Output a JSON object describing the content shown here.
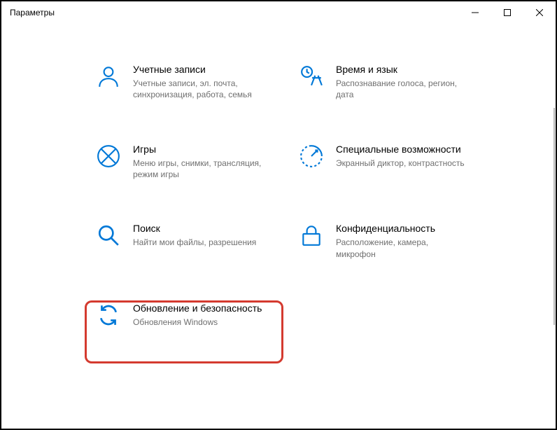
{
  "window": {
    "title": "Параметры"
  },
  "tiles": {
    "accounts": {
      "title": "Учетные записи",
      "desc": "Учетные записи, эл. почта, синхронизация, работа, семья"
    },
    "time": {
      "title": "Время и язык",
      "desc": "Распознавание голоса, регион, дата"
    },
    "gaming": {
      "title": "Игры",
      "desc": "Меню игры, снимки, трансляция, режим игры"
    },
    "ease": {
      "title": "Специальные возможности",
      "desc": "Экранный диктор, контрастность"
    },
    "search": {
      "title": "Поиск",
      "desc": "Найти мои файлы, разрешения"
    },
    "privacy": {
      "title": "Конфиденциальность",
      "desc": "Расположение, камера, микрофон"
    },
    "update": {
      "title": "Обновление и безопасность",
      "desc": "Обновления Windows"
    }
  }
}
